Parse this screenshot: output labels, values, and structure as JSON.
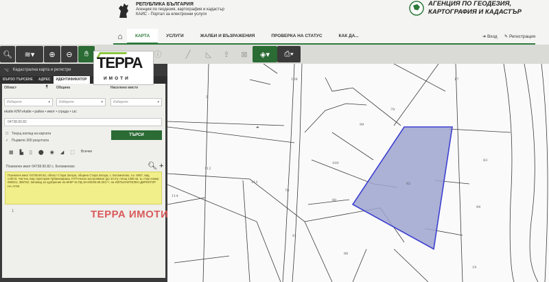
{
  "header": {
    "agency_left": {
      "line1": "РЕПУБЛИКА БЪЛГАРИЯ",
      "line2": "Агенция по геодезия, картография и кадастър",
      "line3": "КАИС - Портал за електронни услуги"
    },
    "agency_right": {
      "line1": "АГЕНЦИЯ ПО ГЕОДЕЗИЯ,",
      "line2": "КАРТОГРАФИЯ И КАДАСТЪР"
    }
  },
  "nav": {
    "items": [
      "КАРТА",
      "УСЛУГИ",
      "ЖАЛБИ И ВЪЗРАЖЕНИЯ",
      "ПРОВЕРКА НА СТАТУС",
      "КАК ДА..."
    ],
    "login": "Вход",
    "register": "Регистрация"
  },
  "panel": {
    "title": "Кадастрална карта и регистри",
    "tabs": [
      "БЪРЗО ТЪРСЕНЕ",
      "АДРЕС",
      "ИДЕНТИФИКАТОР"
    ],
    "oblast_label": "Област",
    "obshtina_label": "Община",
    "naseleno_label": "Населено място",
    "select_placeholder": "Изберете",
    "ekatte_label": "ekatte КЛИ ekatte • район • имот • сграда • сзс",
    "ekatte_value": "04738.90.82",
    "search_button": "ТЪРСИ",
    "only_visible": "Текущ изглед на картата",
    "first_results": "Първите 200 резултата",
    "all_label": "Всички",
    "result_title": "Поземлен имот 04738.90.82 с. Богомилово",
    "result_text": "Поземлен имот 04738.90.82, област Стара Загора, община Стара Загора, с. Богомилово, п.к. 6057, вид собств. Частна, вид територия Урбанизирана, НТП Ниско застрояване (до 10 m), площ 1380 кв. м, стар номер 090021, 386762; Заповед за одобрение на КККР № РД-18-400/25.09.2017 г. на ИЗПЪЛНИТЕЛЕН ДИРЕКТОР НА АГКК",
    "page_number": "1"
  },
  "logo": {
    "big": "ТЕРРА",
    "sub": "ИМОТИ"
  },
  "watermark": "ТЕРРА ИМОТИ",
  "map": {
    "parcels": [
      "109",
      "17",
      "5",
      "79",
      "99",
      "112",
      "113",
      "100",
      "83",
      "82",
      "78",
      "80",
      "84",
      "114",
      "81",
      "86",
      "19"
    ],
    "highlight_color": "#9ea3cf",
    "highlight_stroke": "#3b3fd0"
  }
}
